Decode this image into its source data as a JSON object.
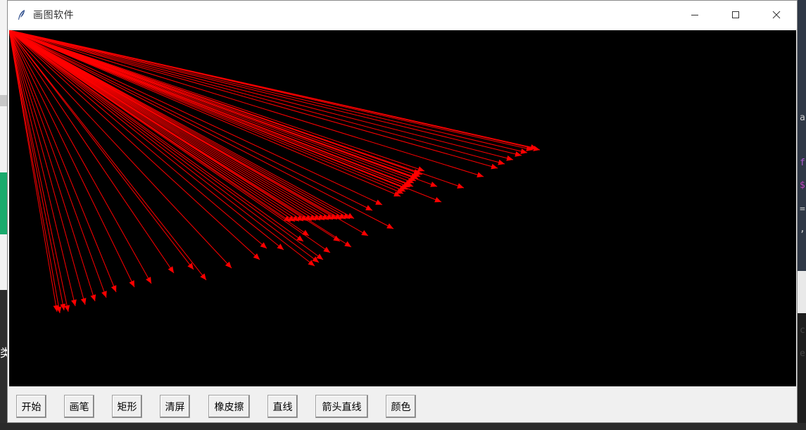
{
  "window": {
    "title": "画图软件",
    "icon": "feather-icon",
    "controls": [
      "minimize-icon",
      "maximize-icon",
      "close-icon"
    ]
  },
  "canvas": {
    "background": "#000000",
    "stroke_color": "#ff0000",
    "content": "red arrow lines radiating from the top-left corner"
  },
  "toolbar": {
    "buttons": [
      "开始",
      "画笔",
      "矩形",
      "清屏",
      "橡皮擦",
      "直线",
      "箭头直线",
      "颜色"
    ]
  },
  "background": {
    "left_char": "类",
    "right_chars": [
      "a",
      "f",
      "$",
      "=",
      ",",
      "c",
      "e"
    ]
  }
}
